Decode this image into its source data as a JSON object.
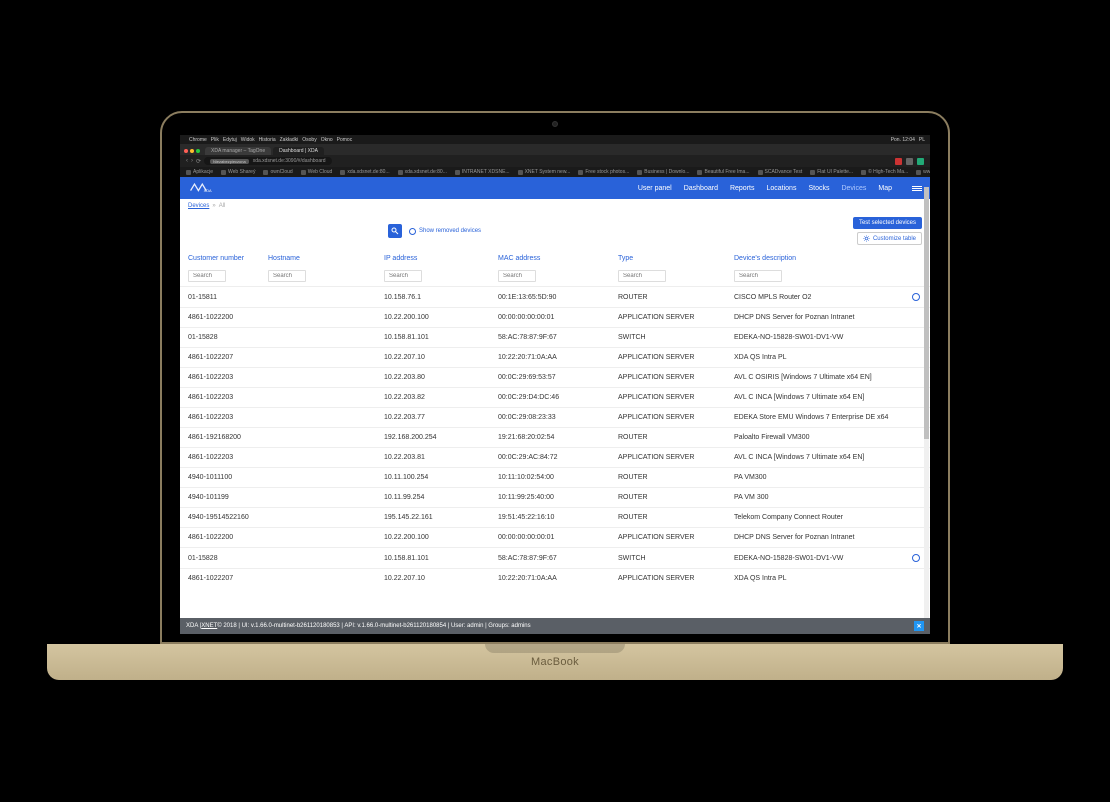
{
  "mac": {
    "apple": "",
    "menu": [
      "Chrome",
      "Plik",
      "Edytuj",
      "Widok",
      "Historia",
      "Zakładki",
      "Osoby",
      "Okno",
      "Pomoc"
    ],
    "right": {
      "time": "Pon. 12:04",
      "lang": "PL"
    }
  },
  "browser": {
    "tabs": [
      {
        "label": "XDA manager – TagOne"
      },
      {
        "label": "Dashboard | XDA"
      }
    ],
    "url": {
      "badge": "Niezabezpieczona",
      "host": "xda.xdsnet.de:3090/#/dashboard"
    },
    "bookmarks": [
      "Aplikacje",
      "Web Shareý",
      "ownCloud",
      "Web Cloud",
      "xda.xdsnet.de:80...",
      "xda.xdsnet.de:80...",
      "INTRANET XDSNE...",
      "XNET System new...",
      "Free stock photos...",
      "Business | Downlo...",
      "Beautiful Free Ima...",
      "SCADvance Test",
      "Flat UI Palette...",
      "© High-Tech Ma...",
      "www.goo..."
    ]
  },
  "header": {
    "logo": "XDA",
    "nav": [
      "User panel",
      "Dashboard",
      "Reports",
      "Locations",
      "Stocks",
      "Devices",
      "Map"
    ],
    "active": "Devices"
  },
  "breadcrumb": {
    "root": "Devices",
    "sep": "»",
    "current": "All"
  },
  "toolbar": {
    "show_removed": "Show removed devices",
    "test_btn": "Test selected devices",
    "customize_btn": "Customize table",
    "search_ph": "Search"
  },
  "table": {
    "columns": [
      "Customer number",
      "Hostname",
      "IP address",
      "MAC address",
      "Type",
      "Device's description"
    ],
    "filter_ph": "Search",
    "rows": [
      {
        "c": "01-15811",
        "h": "",
        "ip": "10.158.76.1",
        "mac": "00:1E:13:65:5D:90",
        "t": "ROUTER",
        "d": "CISCO MPLS Router O2",
        "chk": true
      },
      {
        "c": "4861-1022200",
        "h": "",
        "ip": "10.22.200.100",
        "mac": "00:00:00:00:00:01",
        "t": "APPLICATION SERVER",
        "d": "DHCP DNS Server for Poznan Intranet",
        "chk": false
      },
      {
        "c": "01-15828",
        "h": "",
        "ip": "10.158.81.101",
        "mac": "58:AC:78:87:9F:67",
        "t": "SWITCH",
        "d": "EDEKA-NO-15828-SW01-DV1-VW",
        "chk": false
      },
      {
        "c": "4861-1022207",
        "h": "",
        "ip": "10.22.207.10",
        "mac": "10:22:20:71:0A:AA",
        "t": "APPLICATION SERVER",
        "d": "XDA QS Intra PL",
        "chk": false
      },
      {
        "c": "4861-1022203",
        "h": "",
        "ip": "10.22.203.80",
        "mac": "00:0C:29:69:53:57",
        "t": "APPLICATION SERVER",
        "d": "AVL C OSIRIS [Windows 7 Ultimate x64 EN]",
        "chk": false
      },
      {
        "c": "4861-1022203",
        "h": "",
        "ip": "10.22.203.82",
        "mac": "00:0C:29:D4:DC:46",
        "t": "APPLICATION SERVER",
        "d": "AVL C INCA [Windows 7 Ultimate x64 EN]",
        "chk": false
      },
      {
        "c": "4861-1022203",
        "h": "",
        "ip": "10.22.203.77",
        "mac": "00:0C:29:08:23:33",
        "t": "APPLICATION SERVER",
        "d": "EDEKA Store EMU Windows 7 Enterprise DE x64",
        "chk": false
      },
      {
        "c": "4861-192168200",
        "h": "",
        "ip": "192.168.200.254",
        "mac": "19:21:68:20:02:54",
        "t": "ROUTER",
        "d": "Paloalto Firewall VM300",
        "chk": false
      },
      {
        "c": "4861-1022203",
        "h": "",
        "ip": "10.22.203.81",
        "mac": "00:0C:29:AC:84:72",
        "t": "APPLICATION SERVER",
        "d": "AVL C INCA [Windows 7 Ultimate x64 EN]",
        "chk": false
      },
      {
        "c": "4940-1011100",
        "h": "",
        "ip": "10.11.100.254",
        "mac": "10:11:10:02:54:00",
        "t": "ROUTER",
        "d": "PA VM300",
        "chk": false
      },
      {
        "c": "4940-101199",
        "h": "",
        "ip": "10.11.99.254",
        "mac": "10:11:99:25:40:00",
        "t": "ROUTER",
        "d": "PA VM 300",
        "chk": false
      },
      {
        "c": "4940-19514522160",
        "h": "",
        "ip": "195.145.22.161",
        "mac": "19:51:45:22:16:10",
        "t": "ROUTER",
        "d": "Telekom Company Connect Router",
        "chk": false
      },
      {
        "c": "4861-1022200",
        "h": "",
        "ip": "10.22.200.100",
        "mac": "00:00:00:00:00:01",
        "t": "APPLICATION SERVER",
        "d": "DHCP DNS Server for Poznan Intranet",
        "chk": false
      },
      {
        "c": "01-15828",
        "h": "",
        "ip": "10.158.81.101",
        "mac": "58:AC:78:87:9F:67",
        "t": "SWITCH",
        "d": "EDEKA-NO-15828-SW01-DV1-VW",
        "chk": true
      },
      {
        "c": "4861-1022207",
        "h": "",
        "ip": "10.22.207.10",
        "mac": "10:22:20:71:0A:AA",
        "t": "APPLICATION SERVER",
        "d": "XDA QS Intra PL",
        "chk": false
      }
    ]
  },
  "footer": {
    "pre": "XDA | ",
    "link": "XNET",
    "rest": " © 2018 | UI: v.1.66.0-multinet-b261120180853 | API: v.1.66.0-multinet-b261120180854 | User: admin | Groups: admins"
  },
  "laptop_brand": "MacBook"
}
